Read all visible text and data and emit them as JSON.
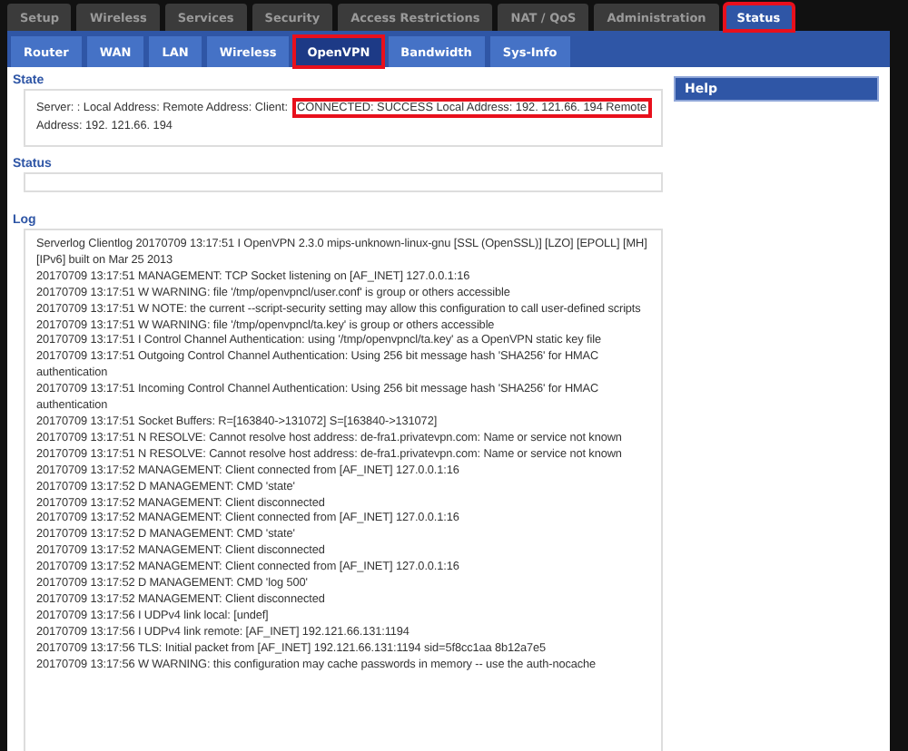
{
  "main_tabs": [
    {
      "label": "Setup",
      "selected": false,
      "highlighted": false
    },
    {
      "label": "Wireless",
      "selected": false,
      "highlighted": false
    },
    {
      "label": "Services",
      "selected": false,
      "highlighted": false
    },
    {
      "label": "Security",
      "selected": false,
      "highlighted": false
    },
    {
      "label": "Access Restrictions",
      "selected": false,
      "highlighted": false
    },
    {
      "label": "NAT / QoS",
      "selected": false,
      "highlighted": false
    },
    {
      "label": "Administration",
      "selected": false,
      "highlighted": false
    },
    {
      "label": "Status",
      "selected": true,
      "highlighted": true
    }
  ],
  "sub_tabs": [
    {
      "label": "Router",
      "selected": false,
      "highlighted": false
    },
    {
      "label": "WAN",
      "selected": false,
      "highlighted": false
    },
    {
      "label": "LAN",
      "selected": false,
      "highlighted": false
    },
    {
      "label": "Wireless",
      "selected": false,
      "highlighted": false
    },
    {
      "label": "OpenVPN",
      "selected": true,
      "highlighted": true
    },
    {
      "label": "Bandwidth",
      "selected": false,
      "highlighted": false
    },
    {
      "label": "Sys-Info",
      "selected": false,
      "highlighted": false
    }
  ],
  "state": {
    "title": "State",
    "text": "Server: : Local Address: Remote Address: Client:",
    "highlighted_text": "CONNECTED: SUCCESS Local Address: 192. 121.66. 194 Remote",
    "text_after": "Address: 192. 121.66. 194"
  },
  "status": {
    "title": "Status"
  },
  "log": {
    "title": "Log",
    "lines": [
      "Serverlog Clientlog 20170709 13:17:51 I OpenVPN 2.3.0 mips-unknown-linux-gnu [SSL (OpenSSL)] [LZO] [EPOLL] [MH] [IPv6] built on Mar 25 2013",
      "20170709 13:17:51 MANAGEMENT: TCP Socket listening on [AF_INET] 127.0.0.1:16",
      "20170709 13:17:51 W WARNING: file '/tmp/openvpncl/user.conf' is group or others accessible",
      "20170709 13:17:51 W NOTE: the current --script-security setting may allow this configuration to call user-defined scripts",
      "20170709 13:17:51 W WARNING: file '/tmp/openvpncl/ta.key' is group or others accessible",
      "20170709 13:17:51 I Control Channel Authentication: using '/tmp/openvpncl/ta.key' as a OpenVPN static key file",
      "20170709 13:17:51 Outgoing Control Channel Authentication: Using 256 bit message hash 'SHA256' for HMAC authentication",
      "20170709 13:17:51 Incoming Control Channel Authentication: Using 256 bit message hash 'SHA256' for HMAC authentication",
      "20170709 13:17:51 Socket Buffers: R=[163840->131072] S=[163840->131072]",
      "20170709 13:17:51 N RESOLVE: Cannot resolve host address: de-fra1.privatevpn.com: Name or service not known",
      "20170709 13:17:51 N RESOLVE: Cannot resolve host address: de-fra1.privatevpn.com: Name or service not known",
      "20170709 13:17:52 MANAGEMENT: Client connected from [AF_INET] 127.0.0.1:16",
      "20170709 13:17:52 D MANAGEMENT: CMD 'state'",
      "20170709 13:17:52 MANAGEMENT: Client disconnected",
      "20170709 13:17:52 MANAGEMENT: Client connected from [AF_INET] 127.0.0.1:16",
      "20170709 13:17:52 D MANAGEMENT: CMD 'state'",
      "20170709 13:17:52 MANAGEMENT: Client disconnected",
      "20170709 13:17:52 MANAGEMENT: Client connected from [AF_INET] 127.0.0.1:16",
      "20170709 13:17:52 D MANAGEMENT: CMD 'log 500'",
      "20170709 13:17:52 MANAGEMENT: Client disconnected",
      "20170709 13:17:56 I UDPv4 link local: [undef]",
      "20170709 13:17:56 I UDPv4 link remote: [AF_INET] 192.121.66.131:1194",
      "20170709 13:17:56 TLS: Initial packet from [AF_INET] 192.121.66.131:1194 sid=5f8cc1aa 8b12a7e5",
      "20170709 13:17:56 W WARNING: this configuration may cache passwords in memory -- use the auth-nocache"
    ]
  },
  "help": {
    "title": "Help"
  }
}
